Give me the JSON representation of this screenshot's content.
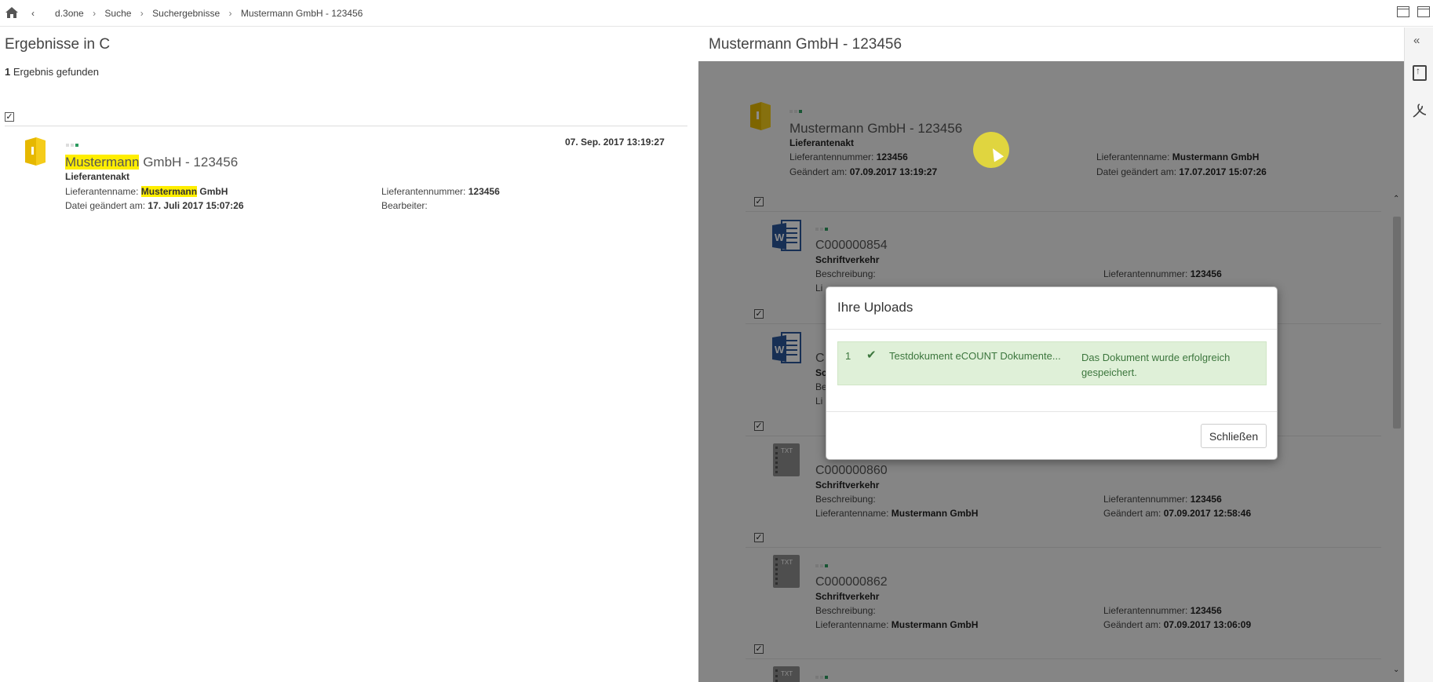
{
  "breadcrumb": {
    "back": "‹",
    "items": [
      "d.3one",
      "Suche",
      "Suchergebnisse",
      "Mustermann GmbH - 123456"
    ]
  },
  "results": {
    "heading": "Ergebnisse in C",
    "count": "1",
    "count_text": "Ergebnis gefunden",
    "item": {
      "title_hl": "Mustermann",
      "title_rest": " GmbH - 123456",
      "type": "Lieferantenakt",
      "date": "07. Sep. 2017 13:19:27",
      "name_label": "Lieferantenname:",
      "name_hl": "Mustermann",
      "name_rest": " GmbH",
      "number_label": "Lieferantennummer:",
      "number_value": "123456",
      "changed_label": "Datei geändert am:",
      "changed_value": "17. Juli 2017 15:07:26",
      "editor_label": "Bearbeiter:"
    }
  },
  "preview": {
    "heading": "Mustermann GmbH - 123456",
    "file": {
      "title": "Mustermann GmbH - 123456",
      "type": "Lieferantenakt",
      "number_label": "Lieferantennummer:",
      "number_value": "123456",
      "changed_label": "Geändert am:",
      "changed_value": "07.09.2017 13:19:27",
      "name_label": "Lieferantenname:",
      "name_value": "Mustermann GmbH",
      "fchanged_label": "Datei geändert am:",
      "fchanged_value": "17.07.2017 15:07:26"
    },
    "docs": [
      {
        "title": "C000000854",
        "type": "Schriftverkehr",
        "desc_label": "Beschreibung:",
        "number_label": "Lieferantennummer:",
        "number_value": "123456",
        "name_label": "Li"
      },
      {
        "title": "C",
        "type": "Sc",
        "desc_label": "Be",
        "name_label": "Li"
      },
      {
        "title": "C000000860",
        "type": "Schriftverkehr",
        "desc_label": "Beschreibung:",
        "number_label": "Lieferantennummer:",
        "number_value": "123456",
        "name_label": "Lieferantenname:",
        "name_value": "Mustermann GmbH",
        "changed_label": "Geändert am:",
        "changed_value": "07.09.2017 12:58:46"
      },
      {
        "title": "C000000862",
        "type": "Schriftverkehr",
        "desc_label": "Beschreibung:",
        "number_label": "Lieferantennummer:",
        "number_value": "123456",
        "name_label": "Lieferantenname:",
        "name_value": "Mustermann GmbH",
        "changed_label": "Geändert am:",
        "changed_value": "07.09.2017 13:06:09"
      }
    ]
  },
  "sidebar": {
    "collapse": "«"
  },
  "modal": {
    "title": "Ihre Uploads",
    "row_number": "1",
    "filename": "Testdokument eCOUNT Dokumente...",
    "message": "Das Dokument wurde erfolgreich gespeichert.",
    "close_label": "Schließen"
  },
  "colors": {
    "highlight": "#ffee00",
    "success_bg": "#dff0d8",
    "success_text": "#3c763d",
    "folder": "#e6b800",
    "word": "#2b579a"
  }
}
